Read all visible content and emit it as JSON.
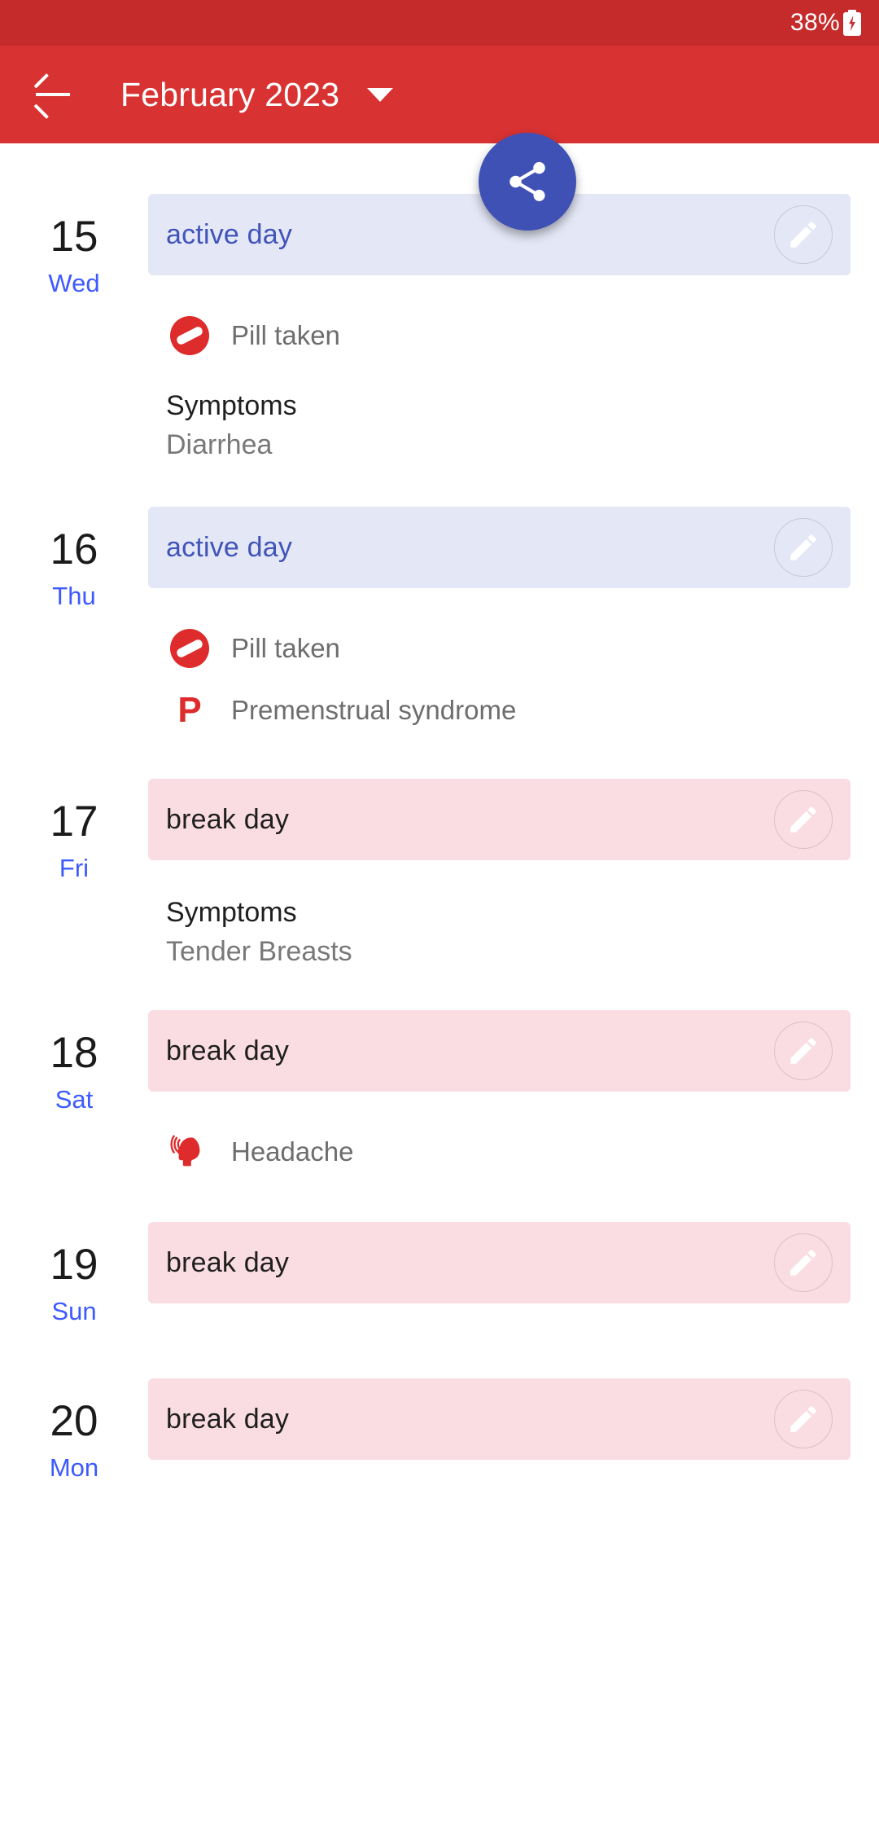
{
  "status_bar": {
    "battery_percent": "38%",
    "battery_icon": "battery-charging-icon"
  },
  "app_bar": {
    "back_icon": "back-arrow-icon",
    "title": "February 2023",
    "dropdown_icon": "chevron-down-icon",
    "fab_icon": "share-icon",
    "colors": {
      "status_bar": "#C62B2B",
      "app_bar": "#D83232",
      "fab": "#3F51B5"
    }
  },
  "labels": {
    "active_day": "active day",
    "break_day": "break day",
    "symptoms_title": "Symptoms",
    "edit_icon": "pencil-icon"
  },
  "days": [
    {
      "num": "15",
      "weekday": "Wed",
      "banner": "active day",
      "banner_type": "active",
      "entries": [
        {
          "icon": "pill-icon",
          "text": "Pill taken"
        }
      ],
      "symptoms_title": "Symptoms",
      "symptoms_value": "Diarrhea"
    },
    {
      "num": "16",
      "weekday": "Thu",
      "banner": "active day",
      "banner_type": "active",
      "entries": [
        {
          "icon": "pill-icon",
          "text": "Pill taken"
        },
        {
          "icon": "pms-p-icon",
          "text": "Premenstrual syndrome"
        }
      ],
      "symptoms_title": "",
      "symptoms_value": ""
    },
    {
      "num": "17",
      "weekday": "Fri",
      "banner": "break day",
      "banner_type": "break",
      "entries": [],
      "symptoms_title": "Symptoms",
      "symptoms_value": "Tender Breasts"
    },
    {
      "num": "18",
      "weekday": "Sat",
      "banner": "break day",
      "banner_type": "break",
      "entries": [
        {
          "icon": "headache-icon",
          "text": "Headache"
        }
      ],
      "symptoms_title": "",
      "symptoms_value": ""
    },
    {
      "num": "19",
      "weekday": "Sun",
      "banner": "break day",
      "banner_type": "break",
      "entries": [],
      "symptoms_title": "",
      "symptoms_value": ""
    },
    {
      "num": "20",
      "weekday": "Mon",
      "banner": "break day",
      "banner_type": "break",
      "entries": [],
      "symptoms_title": "",
      "symptoms_value": ""
    }
  ]
}
